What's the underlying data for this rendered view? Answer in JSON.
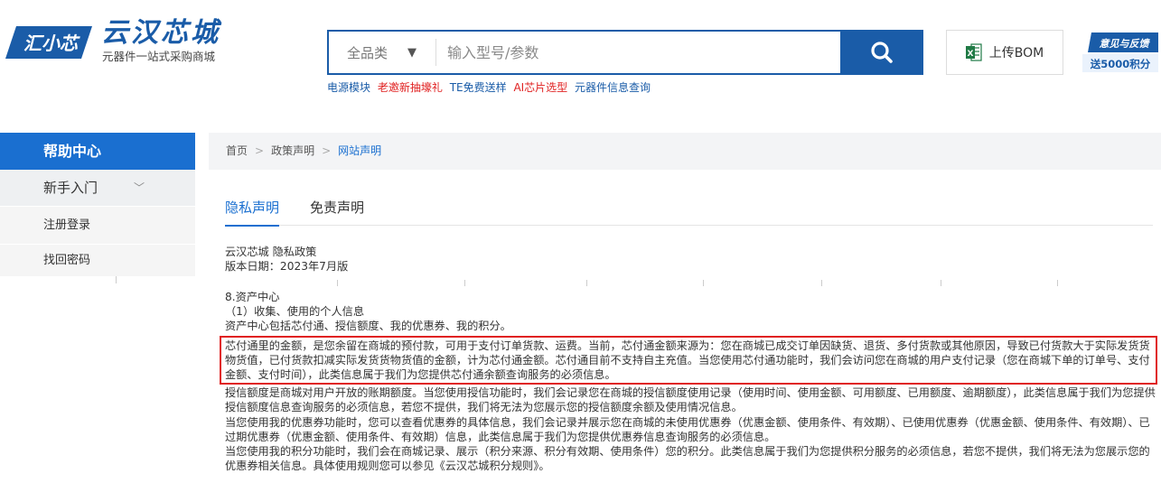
{
  "header": {
    "logo_badge_text": "汇小芯",
    "logo_title": "云汉芯城",
    "logo_subtitle": "元器件一站式采购商城",
    "search": {
      "category": "全品类",
      "placeholder": "输入型号/参数"
    },
    "hot_links": [
      {
        "text": "电源模块",
        "color": "#1a5ca8"
      },
      {
        "text": "老邀新抽壕礼",
        "color": "#e02020"
      },
      {
        "text": "TE免费送样",
        "color": "#1a5ca8"
      },
      {
        "text": "AI芯片选型",
        "color": "#e02020"
      },
      {
        "text": "元器件信息查询",
        "color": "#1a5ca8"
      }
    ],
    "bom_label": "上传BOM",
    "feedback_line1": "意见与反馈",
    "feedback_line2": "送5000积分"
  },
  "sidebar": {
    "title": "帮助中心",
    "group": "新手入门",
    "items": [
      "注册登录",
      "找回密码"
    ]
  },
  "breadcrumb": [
    "首页",
    "政策声明",
    "网站声明"
  ],
  "tabs": [
    "隐私声明",
    "免责声明"
  ],
  "doc": {
    "title_line": "云汉芯城 隐私政策",
    "version_line": "版本日期：2023年7月版",
    "section_title": "8.资产中心",
    "subsection": "（1）收集、使用的个人信息",
    "intro": "资产中心包括芯付通、授信额度、我的优惠券、我的积分。",
    "highlighted": "芯付通里的金额，是您余留在商城的预付款，可用于支付订单货款、运费。当前，芯付通金额来源为：您在商城已成交订单因缺货、退货、多付货款或其他原因，导致已付货款大于实际发货货物货值，已付货款扣减实际发货货物货值的金额，计为芯付通金额。芯付通目前不支持自主充值。当您使用芯付通功能时，我们会访问您在商城的用户支付记录（您在商城下单的订单号、支付金额、支付时间），此类信息属于我们为您提供芯付通余额查询服务的必须信息。",
    "para_credit": "授信额度是商城对用户开放的账期额度。当您使用授信功能时，我们会记录您在商城的授信额度使用记录（使用时间、使用金额、可用额度、已用额度、逾期额度），此类信息属于我们为您提供授信额度信息查询服务的必须信息，若您不提供，我们将无法为您展示您的授信额度余额及使用情况信息。",
    "para_coupon": "当您使用我的优惠券功能时，您可以查看优惠券的具体信息，我们会记录并展示您在商城的未使用优惠券（优惠金额、使用条件、有效期）、已使用优惠券（优惠金额、使用条件、有效期）、已过期优惠券（优惠金额、使用条件、有效期）信息，此类信息属于我们为您提供优惠券信息查询服务的必须信息。",
    "para_points": "当您使用我的积分功能时，我们会在商城记录、展示（积分来源、积分有效期、使用条件）您的积分。此类信息属于我们为您提供积分服务的必须信息，若您不提供，我们将无法为您展示您的优惠券相关信息。具体使用规则您可以参见《云汉芯城积分规则》。"
  },
  "colors": {
    "brand_blue": "#1a5ca8",
    "sidebar_blue": "#1a6fd0",
    "highlight_red": "#e02020"
  },
  "icons": {
    "search": "search-icon",
    "excel": "excel-icon",
    "caret": "caret-down-icon",
    "chevron": "chevron-down-icon"
  }
}
